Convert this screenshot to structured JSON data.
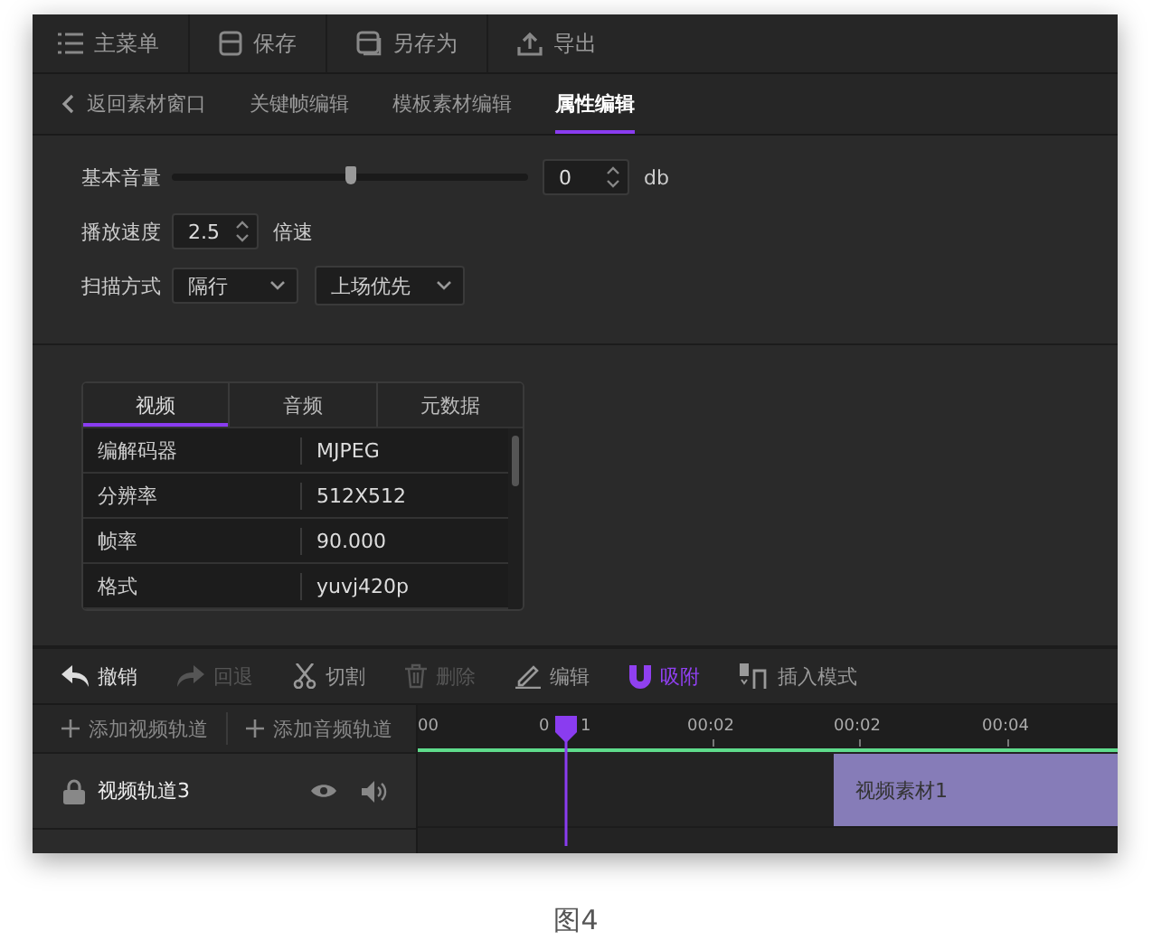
{
  "main_toolbar": [
    {
      "label": "主菜单"
    },
    {
      "label": "保存"
    },
    {
      "label": "另存为"
    },
    {
      "label": "导出"
    }
  ],
  "nav": {
    "back": "返回素材窗口",
    "tabs": [
      {
        "label": "关键帧编辑",
        "selected": false
      },
      {
        "label": "模板素材编辑",
        "selected": false
      },
      {
        "label": "属性编辑",
        "selected": true
      }
    ]
  },
  "properties": {
    "volume": {
      "label": "基本音量",
      "level": 0.5,
      "value": "0",
      "unit": "db"
    },
    "speed": {
      "label": "播放速度",
      "value": "2.5",
      "unit": "倍速"
    },
    "scan": {
      "label": "扫描方式",
      "options": [
        "隔行",
        "上场优先"
      ]
    }
  },
  "info_panel": {
    "tabs": [
      {
        "label": "视频",
        "selected": true
      },
      {
        "label": "音频",
        "selected": false
      },
      {
        "label": "元数据",
        "selected": false
      }
    ],
    "rows": [
      {
        "name": "编解码器",
        "value": "MJPEG"
      },
      {
        "name": "分辨率",
        "value": "512X512"
      },
      {
        "name": "帧率",
        "value": "90.000"
      },
      {
        "name": "格式",
        "value": "yuvj420p"
      }
    ]
  },
  "edit_toolbar": [
    {
      "label": "撤销",
      "disabled": false,
      "active": false
    },
    {
      "label": "回退",
      "disabled": true,
      "active": false
    },
    {
      "label": "切割",
      "disabled": false,
      "active": false
    },
    {
      "label": "删除",
      "disabled": true,
      "active": false
    },
    {
      "label": "编辑",
      "disabled": false,
      "active": false
    },
    {
      "label": "吸附",
      "disabled": false,
      "active": true
    },
    {
      "label": "插入模式",
      "disabled": false,
      "active": false
    }
  ],
  "timeline": {
    "add_buttons": [
      "添加视频轨道",
      "添加音频轨道"
    ],
    "ruler": [
      "00",
      "0",
      "1",
      "00:02",
      "00:02",
      "00:04"
    ],
    "tracks": [
      {
        "name": "视频轨道3",
        "clip": "视频素材1"
      }
    ]
  },
  "caption": "图4"
}
